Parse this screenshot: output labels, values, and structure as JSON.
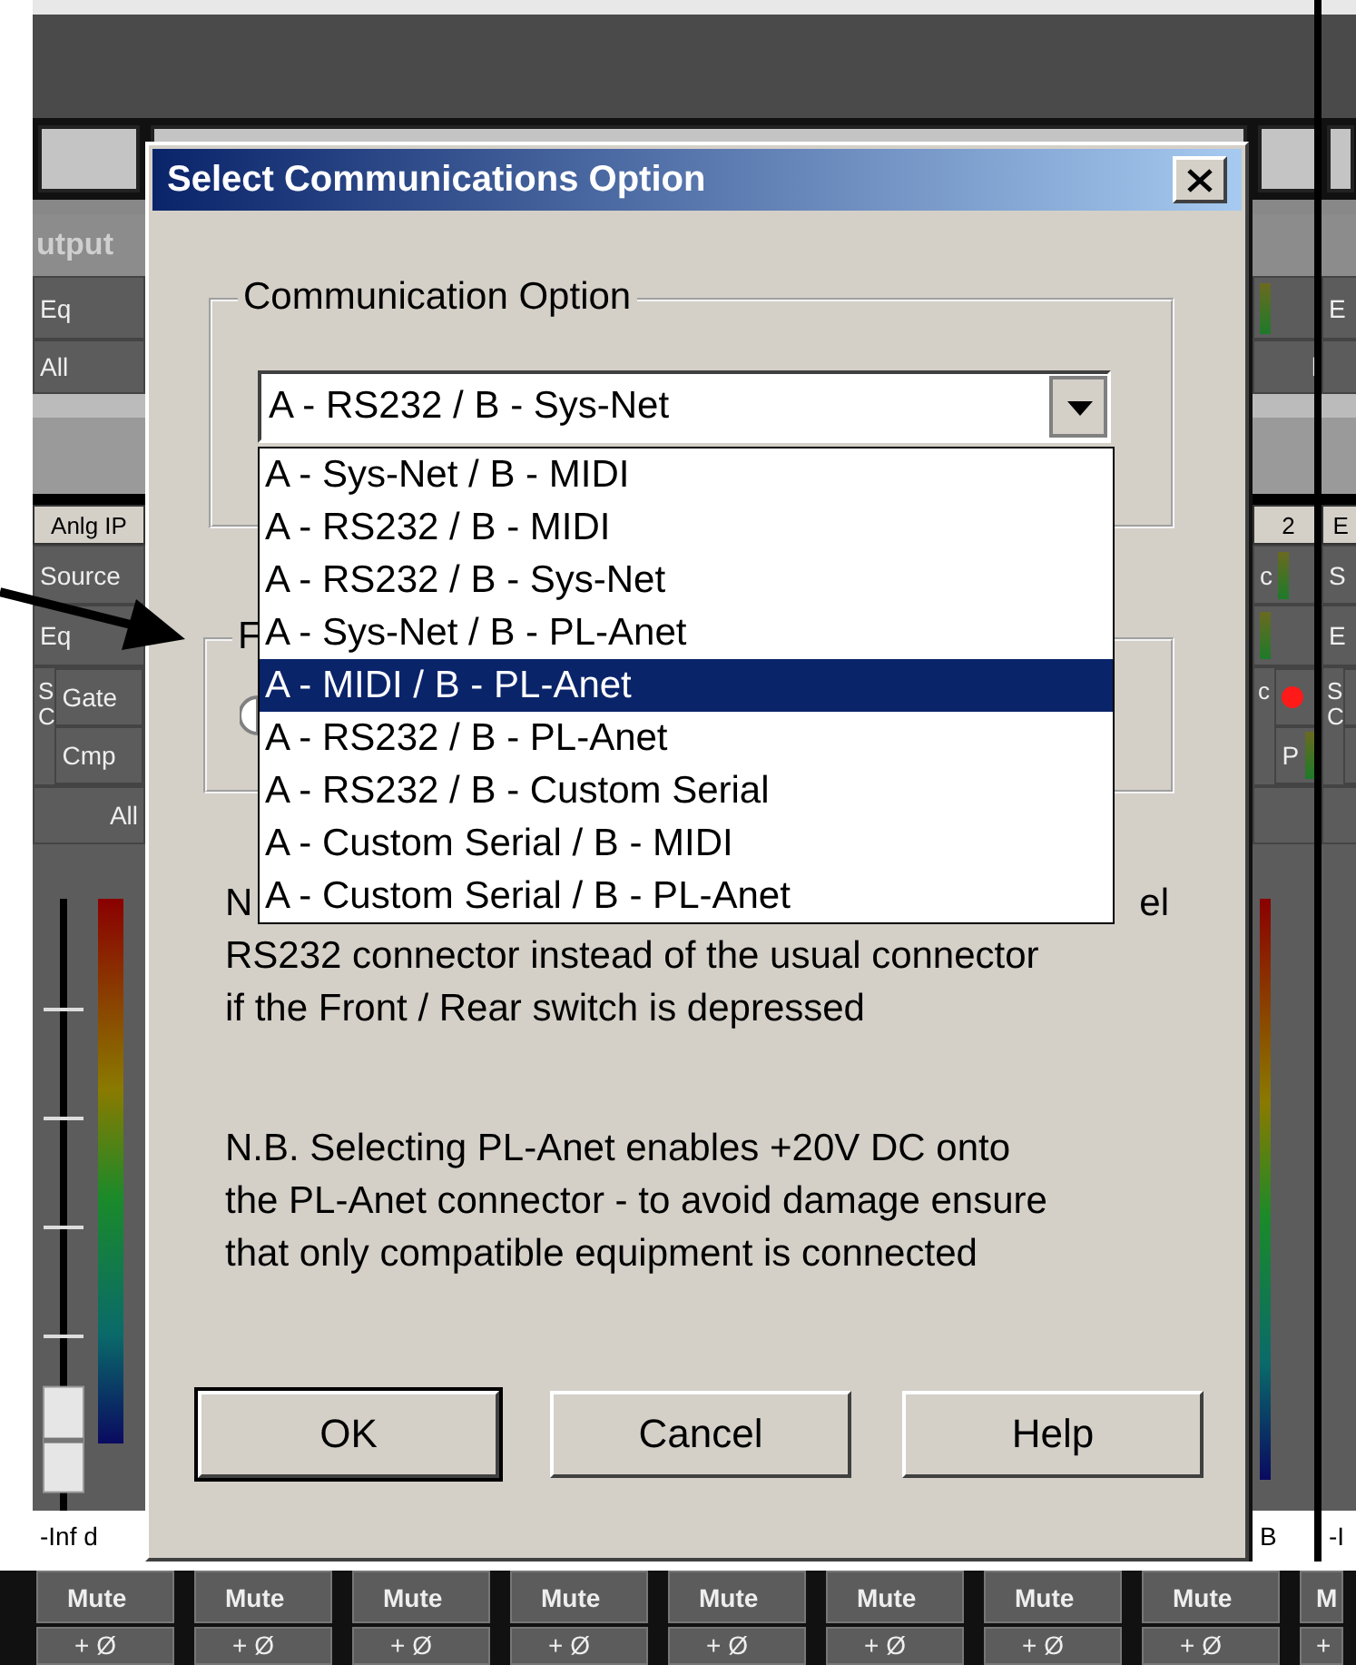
{
  "mixer": {
    "left_strip": {
      "fader": {
        "level": 0.04
      },
      "header": "utput",
      "cell_a": "Eq",
      "cell_b": "All",
      "input": "Anlg IP",
      "source": "Source",
      "eq": "Eq",
      "sc": "S C",
      "gate": "Gate",
      "comp": "Cmp",
      "all": "All",
      "level": "-Inf d"
    },
    "right_strip_a": {
      "cell_b": "l",
      "input": "2",
      "source": "c",
      "sc": "c",
      "indicator_on": true,
      "comp": "P",
      "level": "B"
    },
    "right_strip_b": {
      "cell_a": "E",
      "input": "E",
      "source": "S",
      "eq": "E",
      "sc": "S C",
      "level": "-I"
    },
    "mute_buttons": [
      "Mute",
      "Mute",
      "Mute",
      "Mute",
      "Mute",
      "Mute",
      "Mute",
      "Mute",
      "M"
    ],
    "phase_buttons": [
      "+ Ø",
      "+ Ø",
      "+ Ø",
      "+ Ø",
      "+ Ø",
      "+ Ø",
      "+ Ø",
      "+ Ø",
      "+"
    ]
  },
  "dialog": {
    "title": "Select Communications Option",
    "communication_group": {
      "label": "Communication Option",
      "combo": {
        "value": "A - RS232 / B - Sys-Net",
        "expanded": true
      },
      "options": [
        {
          "label": "A - Sys-Net / B - MIDI",
          "selected": false
        },
        {
          "label": "A - RS232 / B - MIDI",
          "selected": false
        },
        {
          "label": "A - RS232 / B - Sys-Net",
          "selected": false
        },
        {
          "label": "A - Sys-Net / B - PL-Anet",
          "selected": false
        },
        {
          "label": "A - MIDI / B - PL-Anet",
          "selected": true
        },
        {
          "label": "A - RS232 / B - PL-Anet",
          "selected": false
        },
        {
          "label": "A - RS232 / B - Custom Serial",
          "selected": false
        },
        {
          "label": "A - Custom Serial / B - MIDI",
          "selected": false
        },
        {
          "label": "A - Custom Serial / B - PL-Anet",
          "selected": false
        }
      ]
    },
    "second_group": {
      "label": "F",
      "radio": {
        "checked": false
      }
    },
    "note_1": {
      "line_start": "N",
      "line_end": "el",
      "lines": [
        "RS232 connector instead of the usual connector",
        "if the Front / Rear switch is depressed"
      ]
    },
    "note_2": {
      "lines": [
        "N.B. Selecting PL-Anet enables +20V DC onto",
        "the PL-Anet connector - to avoid damage ensure",
        "that only compatible equipment is connected"
      ]
    },
    "buttons": [
      {
        "label": "OK",
        "default": true
      },
      {
        "label": "Cancel",
        "default": false
      },
      {
        "label": "Help",
        "default": false
      }
    ]
  }
}
